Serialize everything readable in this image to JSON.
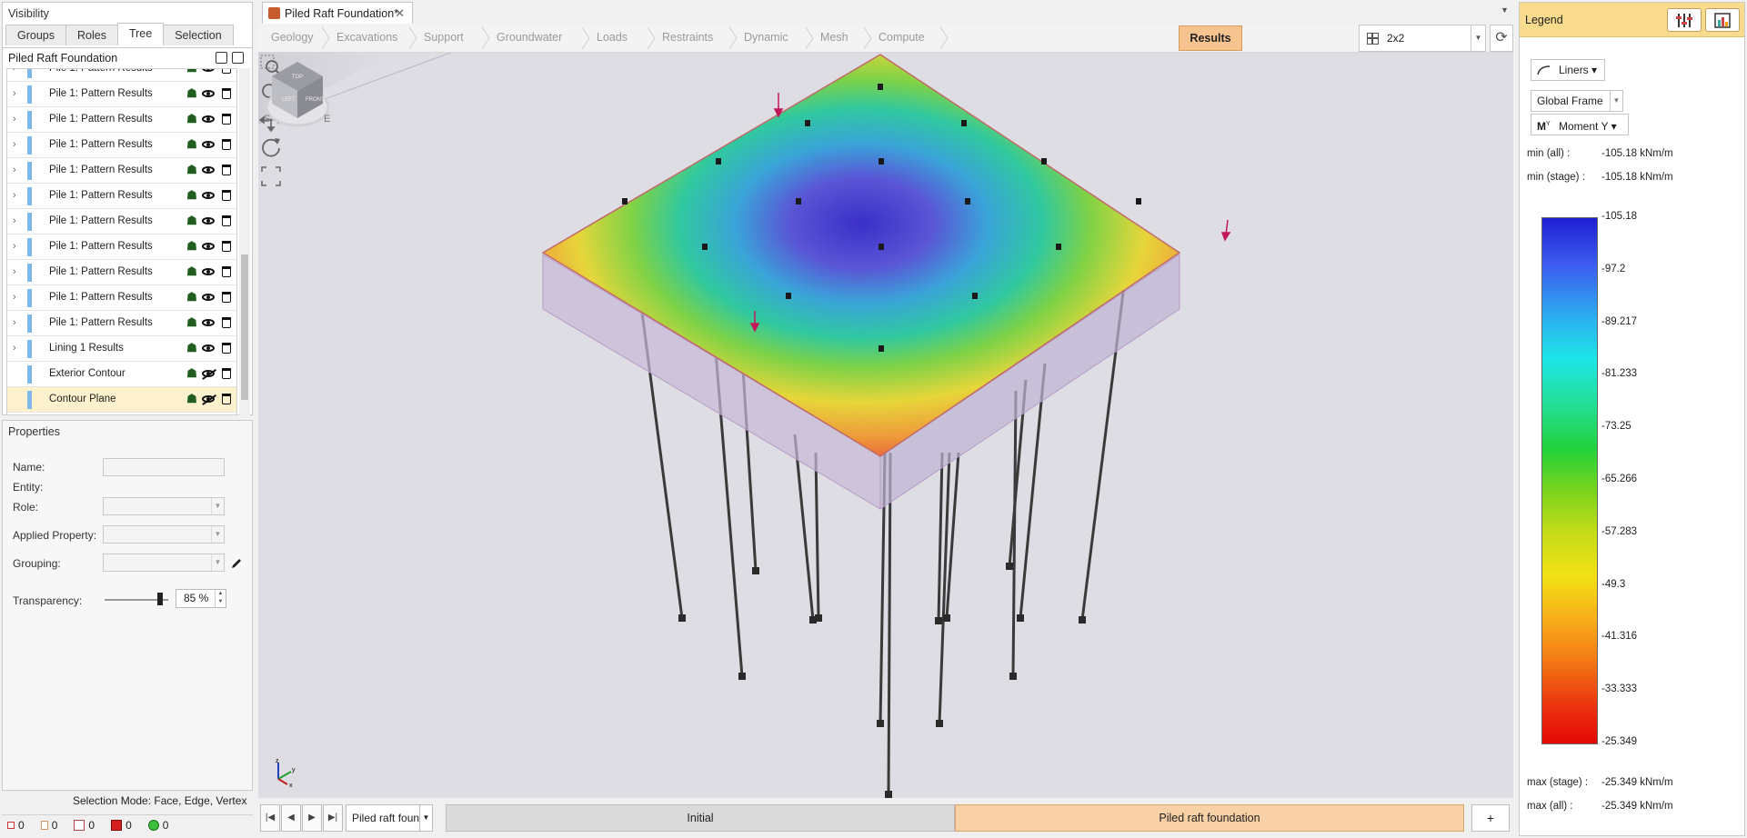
{
  "visibility": {
    "title": "Visibility",
    "tabs": [
      "Groups",
      "Roles",
      "Tree",
      "Selection"
    ],
    "active_tab": "Tree",
    "tree_title": "Piled Raft Foundation",
    "rows": [
      {
        "label": "Pile 1: Pattern  Results",
        "visible": true
      },
      {
        "label": "Pile 1: Pattern  Results",
        "visible": true
      },
      {
        "label": "Pile 1: Pattern  Results",
        "visible": true
      },
      {
        "label": "Pile 1: Pattern  Results",
        "visible": true
      },
      {
        "label": "Pile 1: Pattern  Results",
        "visible": true
      },
      {
        "label": "Pile 1: Pattern  Results",
        "visible": true
      },
      {
        "label": "Pile 1: Pattern  Results",
        "visible": true
      },
      {
        "label": "Pile 1: Pattern  Results",
        "visible": true
      },
      {
        "label": "Pile 1: Pattern  Results",
        "visible": true
      },
      {
        "label": "Pile 1: Pattern  Results",
        "visible": true
      },
      {
        "label": "Pile 1: Pattern  Results",
        "visible": true
      },
      {
        "label": "Lining 1 Results",
        "visible": true
      },
      {
        "label": "Exterior Contour",
        "visible": false
      },
      {
        "label": "Contour Plane",
        "visible": false,
        "selected": true
      }
    ]
  },
  "properties": {
    "title": "Properties",
    "labels": {
      "name": "Name:",
      "entity": "Entity:",
      "role": "Role:",
      "applied_property": "Applied Property:",
      "grouping": "Grouping:",
      "transparency": "Transparency:"
    },
    "transparency_value": "85 %",
    "transparency_level": 0.85,
    "selection_mode": "Selection Mode: Face, Edge, Vertex",
    "status_counts": [
      "0",
      "0",
      "0",
      "0",
      "0"
    ]
  },
  "document": {
    "tab_title": "Piled Raft Foundation*",
    "close_glyph": "✕"
  },
  "workflow": {
    "steps": [
      "Geology",
      "Excavations",
      "Support",
      "Groundwater",
      "Loads",
      "Restraints",
      "Dynamic",
      "Mesh",
      "Compute"
    ],
    "active_step": "Results"
  },
  "view": {
    "layout": "2x2"
  },
  "stages": {
    "current": "Piled raft founc",
    "items": [
      "Initial",
      "Piled raft foundation"
    ],
    "add_label": "+"
  },
  "legend": {
    "title": "Legend",
    "liners_label": "Liners",
    "frame_label": "Global Frame",
    "quantity_label": "Moment Y",
    "quantity_prefix": "M",
    "min_all": "min (all) :",
    "min_all_value": "-105.18 kNm/m",
    "min_stage": "min (stage) :",
    "min_stage_value": "-105.18 kNm/m",
    "ticks": [
      "-105.18",
      "-97.2",
      "-89.217",
      "-81.233",
      "-73.25",
      "-65.266",
      "-57.283",
      "-49.3",
      "-41.316",
      "-33.333",
      "-25.349"
    ],
    "max_stage": "max (stage) :",
    "max_stage_value": "-25.349 kNm/m",
    "max_all": "max (all) :",
    "max_all_value": "-25.349 kNm/m"
  },
  "nav_cube": {
    "faces": [
      "TOP",
      "LEFT",
      "FRONT"
    ],
    "compass": [
      "S",
      "E"
    ]
  },
  "axis_triad": [
    "z",
    "y",
    "x"
  ],
  "colors": {
    "accent_results": "#f7c48f",
    "legend_header": "#f8db8c",
    "selected_row": "#fdf1cd"
  }
}
